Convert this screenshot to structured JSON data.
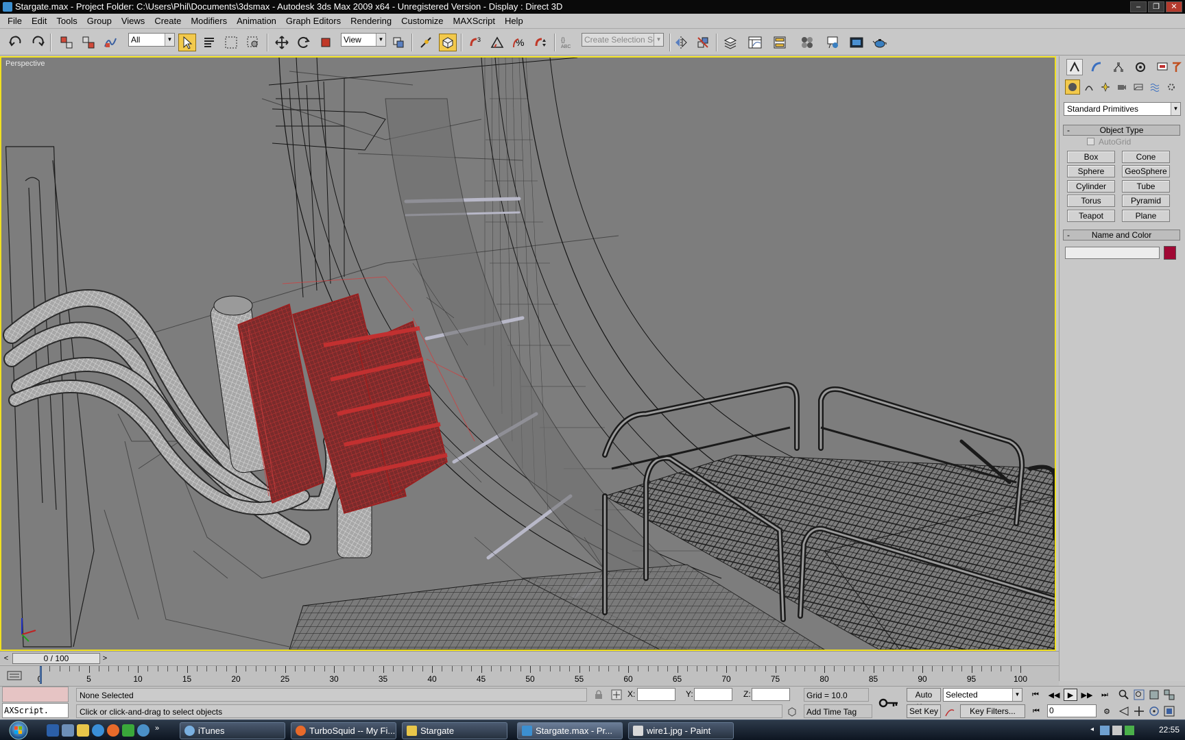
{
  "window": {
    "title": "Stargate.max     - Project Folder: C:\\Users\\Phil\\Documents\\3dsmax     - Autodesk 3ds Max  2009 x64   - Unregistered Version     - Display : Direct 3D"
  },
  "menu": [
    "File",
    "Edit",
    "Tools",
    "Group",
    "Views",
    "Create",
    "Modifiers",
    "Animation",
    "Graph Editors",
    "Rendering",
    "Customize",
    "MAXScript",
    "Help"
  ],
  "toolbar": {
    "selection_filter": "All",
    "reference_coord": "View",
    "named_selection_placeholder": "Create Selection Set"
  },
  "viewport": {
    "label": "Perspective"
  },
  "command_panel": {
    "category_dropdown": "Standard Primitives",
    "object_type_title": "Object Type",
    "autogrid_label": "AutoGrid",
    "buttons": [
      "Box",
      "Cone",
      "Sphere",
      "GeoSphere",
      "Cylinder",
      "Tube",
      "Torus",
      "Pyramid",
      "Teapot",
      "Plane"
    ],
    "name_color_title": "Name and Color",
    "object_color": "#a00834"
  },
  "time_slider": {
    "position_label": "0 / 100"
  },
  "track_bar": {
    "tick_labels": [
      "0",
      "5",
      "10",
      "15",
      "20",
      "25",
      "30",
      "35",
      "40",
      "45",
      "50",
      "55",
      "60",
      "65",
      "70",
      "75",
      "80",
      "85",
      "90",
      "95",
      "100"
    ]
  },
  "status": {
    "maxscript_prompt": "AXScript.",
    "selection": "None Selected",
    "prompt": "Click or click-and-drag to select objects",
    "x_label": "X:",
    "y_label": "Y:",
    "z_label": "Z:",
    "grid": "Grid = 10.0",
    "add_time_tag": "Add Time Tag",
    "auto_key": "Auto Key",
    "set_key": "Set Key",
    "key_mode": "Selected",
    "key_filters": "Key Filters...",
    "current_frame": "0"
  },
  "taskbar": {
    "items": [
      "iTunes",
      "TurboSquid -- My Fi...",
      "Stargate",
      "Stargate.max    - Pr...",
      "wire1.jpg - Paint"
    ],
    "clock": "22:55"
  },
  "colors": {
    "viewport_bg": "#7d7d7d",
    "active_border": "#f0e020",
    "wire_red": "#9e1e1e"
  }
}
